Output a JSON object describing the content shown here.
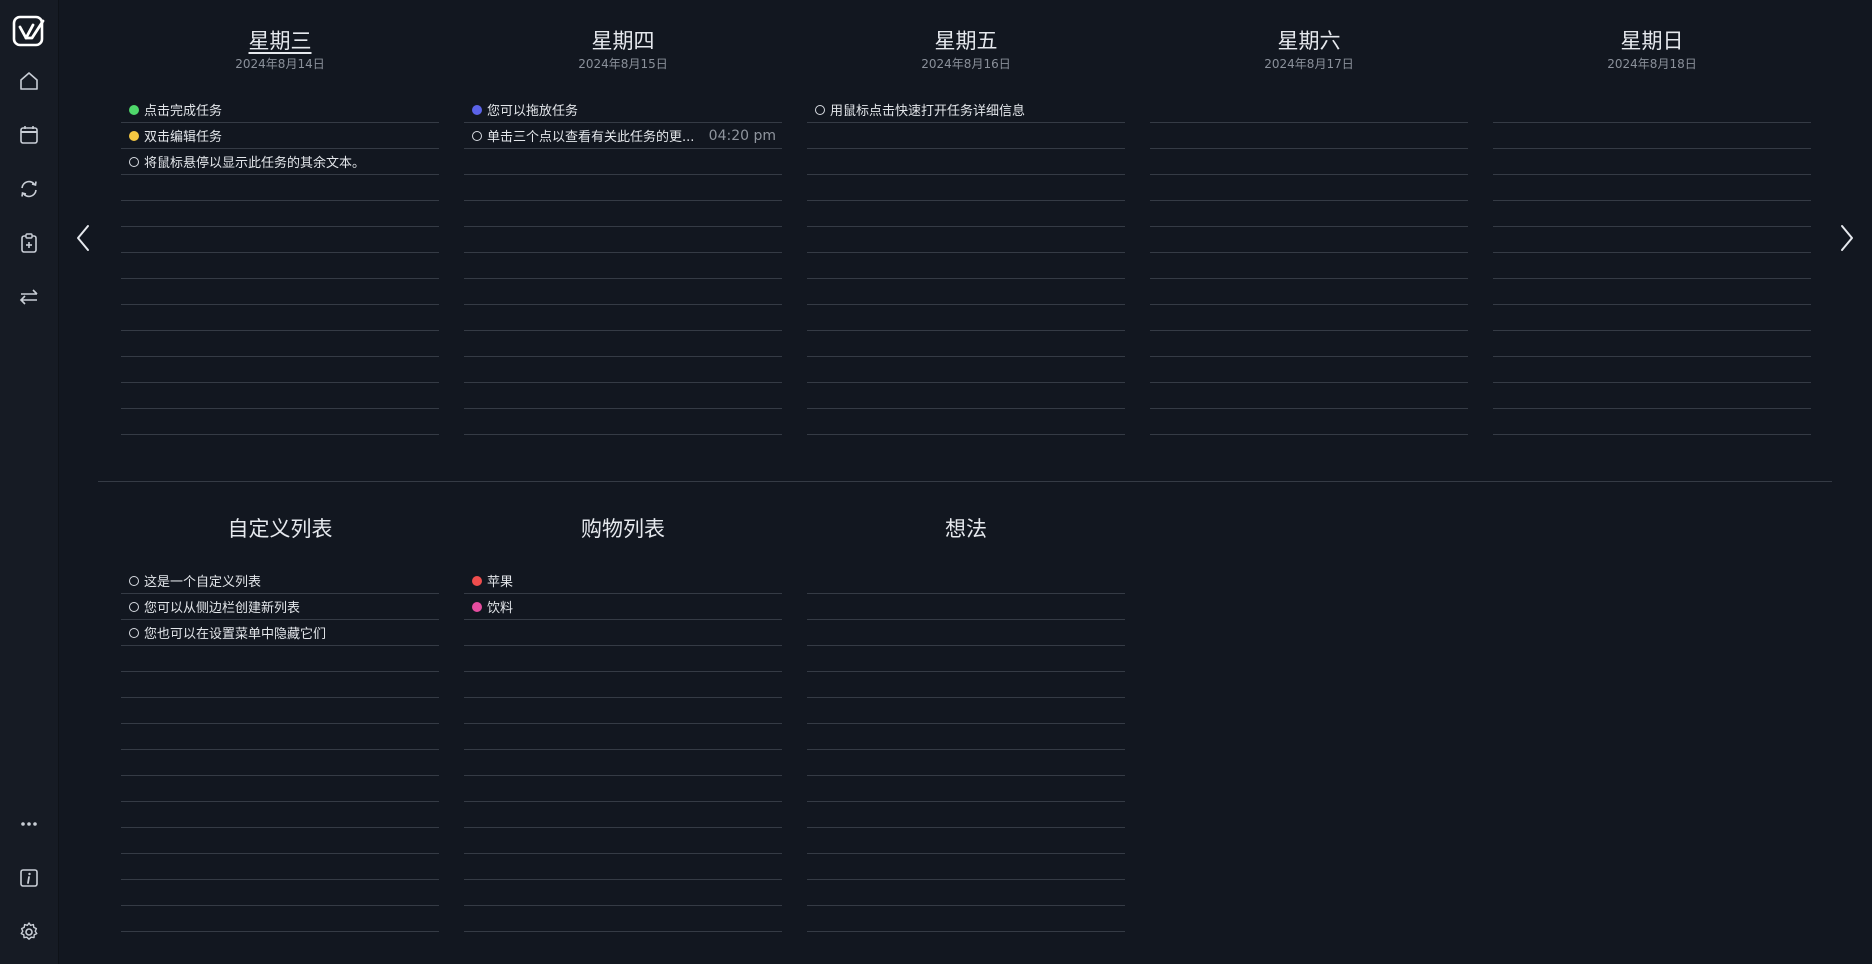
{
  "colors": {
    "background": "#121720",
    "sidebar": "#161b24",
    "line": "#353b45",
    "green": "#4fd86b",
    "yellow": "#f5c842",
    "blue": "#5b63e8",
    "red": "#ef4d4d",
    "pink": "#e64da0"
  },
  "sidebar": {
    "logo_icon": "checkbox-logo-icon",
    "items": [
      {
        "icon": "home-icon"
      },
      {
        "icon": "calendar-icon"
      },
      {
        "icon": "sync-icon"
      },
      {
        "icon": "clipboard-add-icon"
      },
      {
        "icon": "swap-arrows-icon"
      }
    ],
    "bottom": [
      {
        "icon": "more-dots-icon"
      },
      {
        "icon": "info-icon"
      },
      {
        "icon": "gear-icon"
      }
    ]
  },
  "nav": {
    "prev_icon": "chevron-left-icon",
    "next_icon": "chevron-right-icon"
  },
  "week": [
    {
      "day": "星期三",
      "date": "2024年8月14日",
      "today": true,
      "tasks": [
        {
          "text": "点击完成任务",
          "dot": "green"
        },
        {
          "text": "双击编辑任务",
          "dot": "yellow"
        },
        {
          "text": "将鼠标悬停以显示此任务的其余文本。",
          "dot": "empty"
        }
      ]
    },
    {
      "day": "星期四",
      "date": "2024年8月15日",
      "today": false,
      "tasks": [
        {
          "text": "您可以拖放任务",
          "dot": "blue"
        },
        {
          "text": "单击三个点以查看有关此任务的更...",
          "dot": "empty",
          "time": "04:20 pm"
        }
      ]
    },
    {
      "day": "星期五",
      "date": "2024年8月16日",
      "today": false,
      "tasks": [
        {
          "text": "用鼠标点击快速打开任务详细信息",
          "dot": "empty"
        }
      ]
    },
    {
      "day": "星期六",
      "date": "2024年8月17日",
      "today": false,
      "tasks": []
    },
    {
      "day": "星期日",
      "date": "2024年8月18日",
      "today": false,
      "tasks": []
    }
  ],
  "lists": [
    {
      "name": "自定义列表",
      "tasks": [
        {
          "text": "这是一个自定义列表",
          "dot": "empty"
        },
        {
          "text": "您可以从侧边栏创建新列表",
          "dot": "empty"
        },
        {
          "text": "您也可以在设置菜单中隐藏它们",
          "dot": "empty"
        }
      ]
    },
    {
      "name": "购物列表",
      "tasks": [
        {
          "text": "苹果",
          "dot": "red"
        },
        {
          "text": "饮料",
          "dot": "pink"
        }
      ]
    },
    {
      "name": "想法",
      "tasks": []
    }
  ]
}
